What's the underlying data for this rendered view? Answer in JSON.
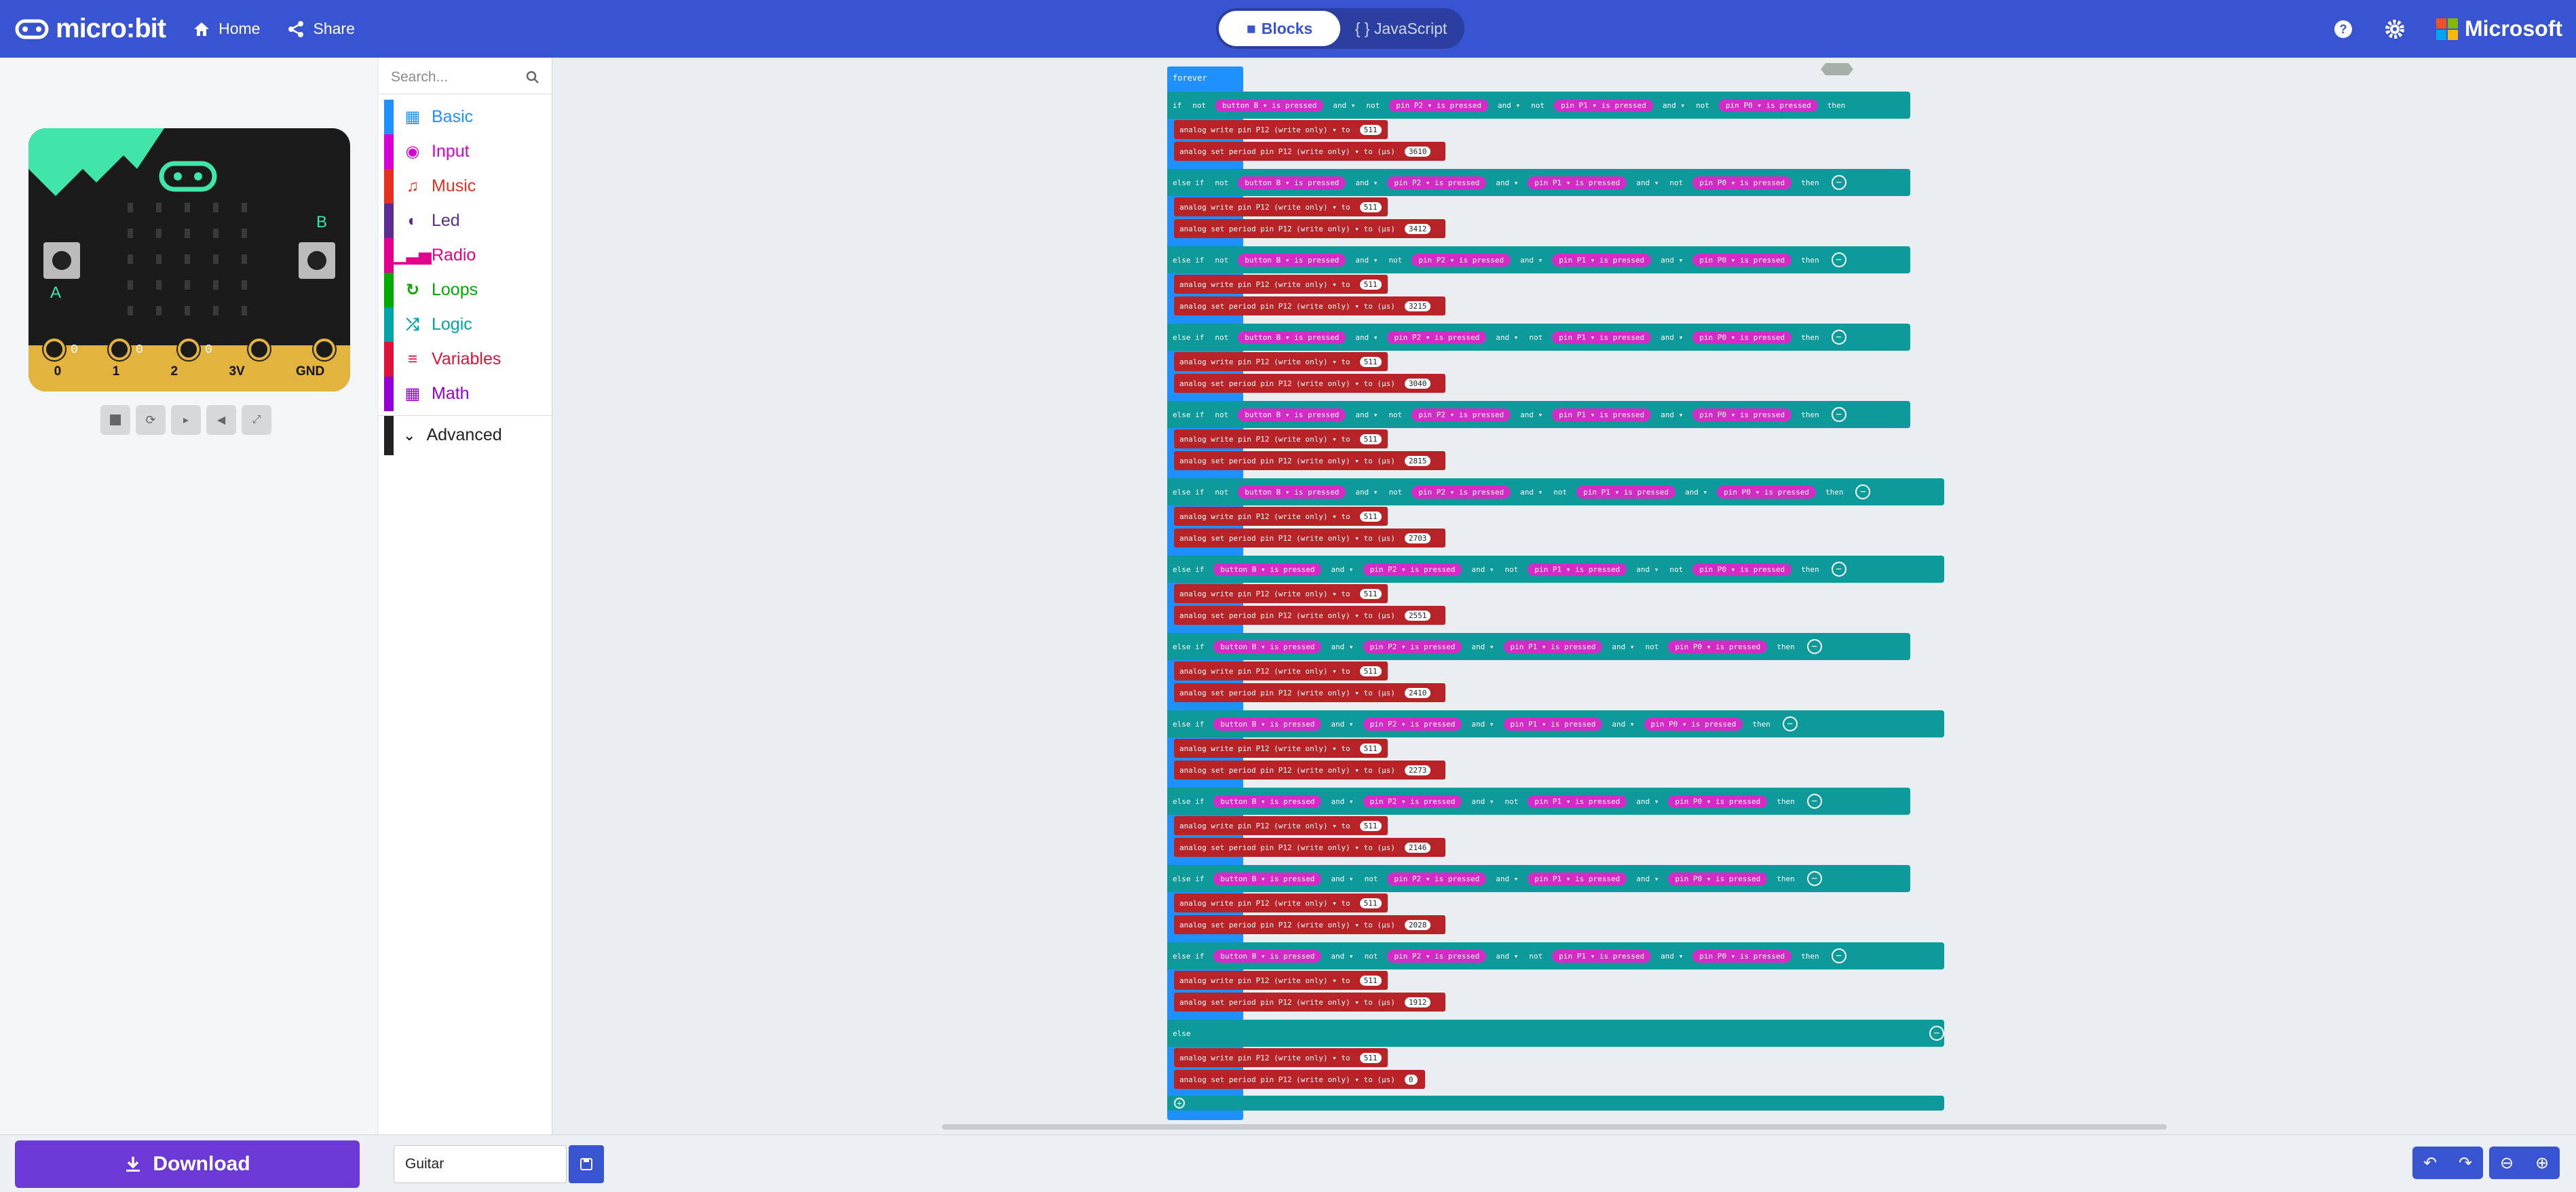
{
  "app": {
    "brand": "micro:bit",
    "home_label": "Home",
    "share_label": "Share",
    "microsoft_label": "Microsoft"
  },
  "modes": {
    "blocks": "Blocks",
    "javascript": "{ } JavaScript"
  },
  "simulator": {
    "pin_labels": [
      "0",
      "1",
      "2",
      "3V",
      "GND"
    ]
  },
  "toolbox": {
    "search_placeholder": "Search...",
    "categories": [
      {
        "label": "Basic",
        "color": "#1e90ff"
      },
      {
        "label": "Input",
        "color": "#d400d4"
      },
      {
        "label": "Music",
        "color": "#e63022"
      },
      {
        "label": "Led",
        "color": "#5c2d91"
      },
      {
        "label": "Radio",
        "color": "#e3008c"
      },
      {
        "label": "Loops",
        "color": "#00aa00"
      },
      {
        "label": "Logic",
        "color": "#00a4a6"
      },
      {
        "label": "Variables",
        "color": "#dc143c"
      },
      {
        "label": "Math",
        "color": "#9400d3"
      }
    ],
    "advanced": "Advanced"
  },
  "project": {
    "name": "Guitar",
    "download_label": "Download"
  },
  "code": {
    "forever": "forever",
    "if": "if",
    "else_if": "else if",
    "else": "else",
    "then": "then",
    "not": "not",
    "and": "and ▾",
    "write_label": "analog write pin  P12 (write only) ▾  to",
    "period_label": "analog set period pin  P12 (write only) ▾  to (µs)",
    "button_pill": "button  B ▾  is pressed",
    "p2_pill": "pin  P2 ▾  is pressed",
    "p1_pill": "pin  P1 ▾  is pressed",
    "p0_pill": "pin  P0 ▾  is pressed",
    "write_value": "511",
    "periods": [
      "3610",
      "3412",
      "3215",
      "3040",
      "2815",
      "2703",
      "2551",
      "2410",
      "2273",
      "2146",
      "2028",
      "1912",
      "0"
    ]
  }
}
